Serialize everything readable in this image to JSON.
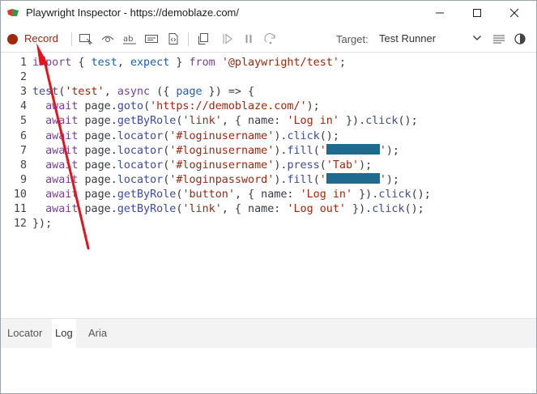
{
  "window": {
    "title": "Playwright Inspector - https://demoblaze.com/",
    "controls": {
      "minimize": "minimize",
      "maximize": "maximize",
      "close": "close"
    }
  },
  "toolbar": {
    "record_label": "Record",
    "target_label": "Target:",
    "target_value": "Test Runner",
    "icons": [
      "pick-locator-icon",
      "assert-visibility-icon",
      "assert-text-icon",
      "assert-value-icon",
      "assert-snapshot-icon",
      "copy-icon",
      "resume-icon",
      "pause-icon",
      "step-over-icon",
      "wrap-lines-icon",
      "theme-toggle-icon"
    ]
  },
  "code": {
    "lines": [
      {
        "n": "1",
        "t": [
          [
            "kw",
            "import"
          ],
          [
            "p",
            " { "
          ],
          [
            "var",
            "test"
          ],
          [
            "p",
            ", "
          ],
          [
            "var",
            "expect"
          ],
          [
            "p",
            " } "
          ],
          [
            "kw",
            "from"
          ],
          [
            "p",
            " "
          ],
          [
            "str",
            "'@playwright/test'"
          ],
          [
            "p",
            ";"
          ]
        ]
      },
      {
        "n": "2",
        "t": []
      },
      {
        "n": "3",
        "t": [
          [
            "fn",
            "test"
          ],
          [
            "p",
            "("
          ],
          [
            "str",
            "'test'"
          ],
          [
            "p",
            ", "
          ],
          [
            "kw",
            "async"
          ],
          [
            "p",
            " ({ "
          ],
          [
            "var",
            "page"
          ],
          [
            "p",
            " }) => {"
          ]
        ]
      },
      {
        "n": "4",
        "t": [
          [
            "p",
            "  "
          ],
          [
            "kw",
            "await"
          ],
          [
            "p",
            " page."
          ],
          [
            "fn",
            "goto"
          ],
          [
            "p",
            "("
          ],
          [
            "str",
            "'https://demoblaze.com/'"
          ],
          [
            "p",
            ");"
          ]
        ]
      },
      {
        "n": "5",
        "t": [
          [
            "p",
            "  "
          ],
          [
            "kw",
            "await"
          ],
          [
            "p",
            " page."
          ],
          [
            "fn",
            "getByRole"
          ],
          [
            "p",
            "("
          ],
          [
            "str",
            "'link'"
          ],
          [
            "p",
            ", { name: "
          ],
          [
            "str",
            "'Log in'"
          ],
          [
            "p",
            " })."
          ],
          [
            "fn",
            "click"
          ],
          [
            "p",
            "();"
          ]
        ]
      },
      {
        "n": "6",
        "t": [
          [
            "p",
            "  "
          ],
          [
            "kw",
            "await"
          ],
          [
            "p",
            " page."
          ],
          [
            "fn",
            "locator"
          ],
          [
            "p",
            "("
          ],
          [
            "str",
            "'#loginusername'"
          ],
          [
            "p",
            ")."
          ],
          [
            "fn",
            "click"
          ],
          [
            "p",
            "();"
          ]
        ]
      },
      {
        "n": "7",
        "t": [
          [
            "p",
            "  "
          ],
          [
            "kw",
            "await"
          ],
          [
            "p",
            " page."
          ],
          [
            "fn",
            "locator"
          ],
          [
            "p",
            "("
          ],
          [
            "str",
            "'#loginusername'"
          ],
          [
            "p",
            ")."
          ],
          [
            "fn",
            "fill"
          ],
          [
            "p",
            "("
          ],
          [
            "str",
            "'"
          ],
          [
            "redact",
            ""
          ],
          [
            "str",
            "'"
          ],
          [
            "p",
            ");"
          ]
        ]
      },
      {
        "n": "8",
        "t": [
          [
            "p",
            "  "
          ],
          [
            "kw",
            "await"
          ],
          [
            "p",
            " page."
          ],
          [
            "fn",
            "locator"
          ],
          [
            "p",
            "("
          ],
          [
            "str",
            "'#loginusername'"
          ],
          [
            "p",
            ")."
          ],
          [
            "fn",
            "press"
          ],
          [
            "p",
            "("
          ],
          [
            "str",
            "'Tab'"
          ],
          [
            "p",
            ");"
          ]
        ]
      },
      {
        "n": "9",
        "t": [
          [
            "p",
            "  "
          ],
          [
            "kw",
            "await"
          ],
          [
            "p",
            " page."
          ],
          [
            "fn",
            "locator"
          ],
          [
            "p",
            "("
          ],
          [
            "str",
            "'#loginpassword'"
          ],
          [
            "p",
            ")."
          ],
          [
            "fn",
            "fill"
          ],
          [
            "p",
            "("
          ],
          [
            "str",
            "'"
          ],
          [
            "redact",
            ""
          ],
          [
            "str",
            "'"
          ],
          [
            "p",
            ");"
          ]
        ]
      },
      {
        "n": "10",
        "t": [
          [
            "p",
            "  "
          ],
          [
            "kw",
            "await"
          ],
          [
            "p",
            " page."
          ],
          [
            "fn",
            "getByRole"
          ],
          [
            "p",
            "("
          ],
          [
            "str",
            "'button'"
          ],
          [
            "p",
            ", { name: "
          ],
          [
            "str",
            "'Log in'"
          ],
          [
            "p",
            " })."
          ],
          [
            "fn",
            "click"
          ],
          [
            "p",
            "();"
          ]
        ]
      },
      {
        "n": "11",
        "t": [
          [
            "p",
            "  "
          ],
          [
            "kw",
            "await"
          ],
          [
            "p",
            " page."
          ],
          [
            "fn",
            "getByRole"
          ],
          [
            "p",
            "("
          ],
          [
            "str",
            "'link'"
          ],
          [
            "p",
            ", { name: "
          ],
          [
            "str",
            "'Log out'"
          ],
          [
            "p",
            " })."
          ],
          [
            "fn",
            "click"
          ],
          [
            "p",
            "();"
          ]
        ]
      },
      {
        "n": "12",
        "t": [
          [
            "p",
            "});"
          ]
        ]
      }
    ]
  },
  "tabs": [
    {
      "label": "Locator",
      "active": false
    },
    {
      "label": "Log",
      "active": true
    },
    {
      "label": "Aria",
      "active": false
    }
  ],
  "colors": {
    "record": "#a1260d",
    "annotation_arrow": "#e3121b",
    "redaction": "#1e6b8f"
  }
}
